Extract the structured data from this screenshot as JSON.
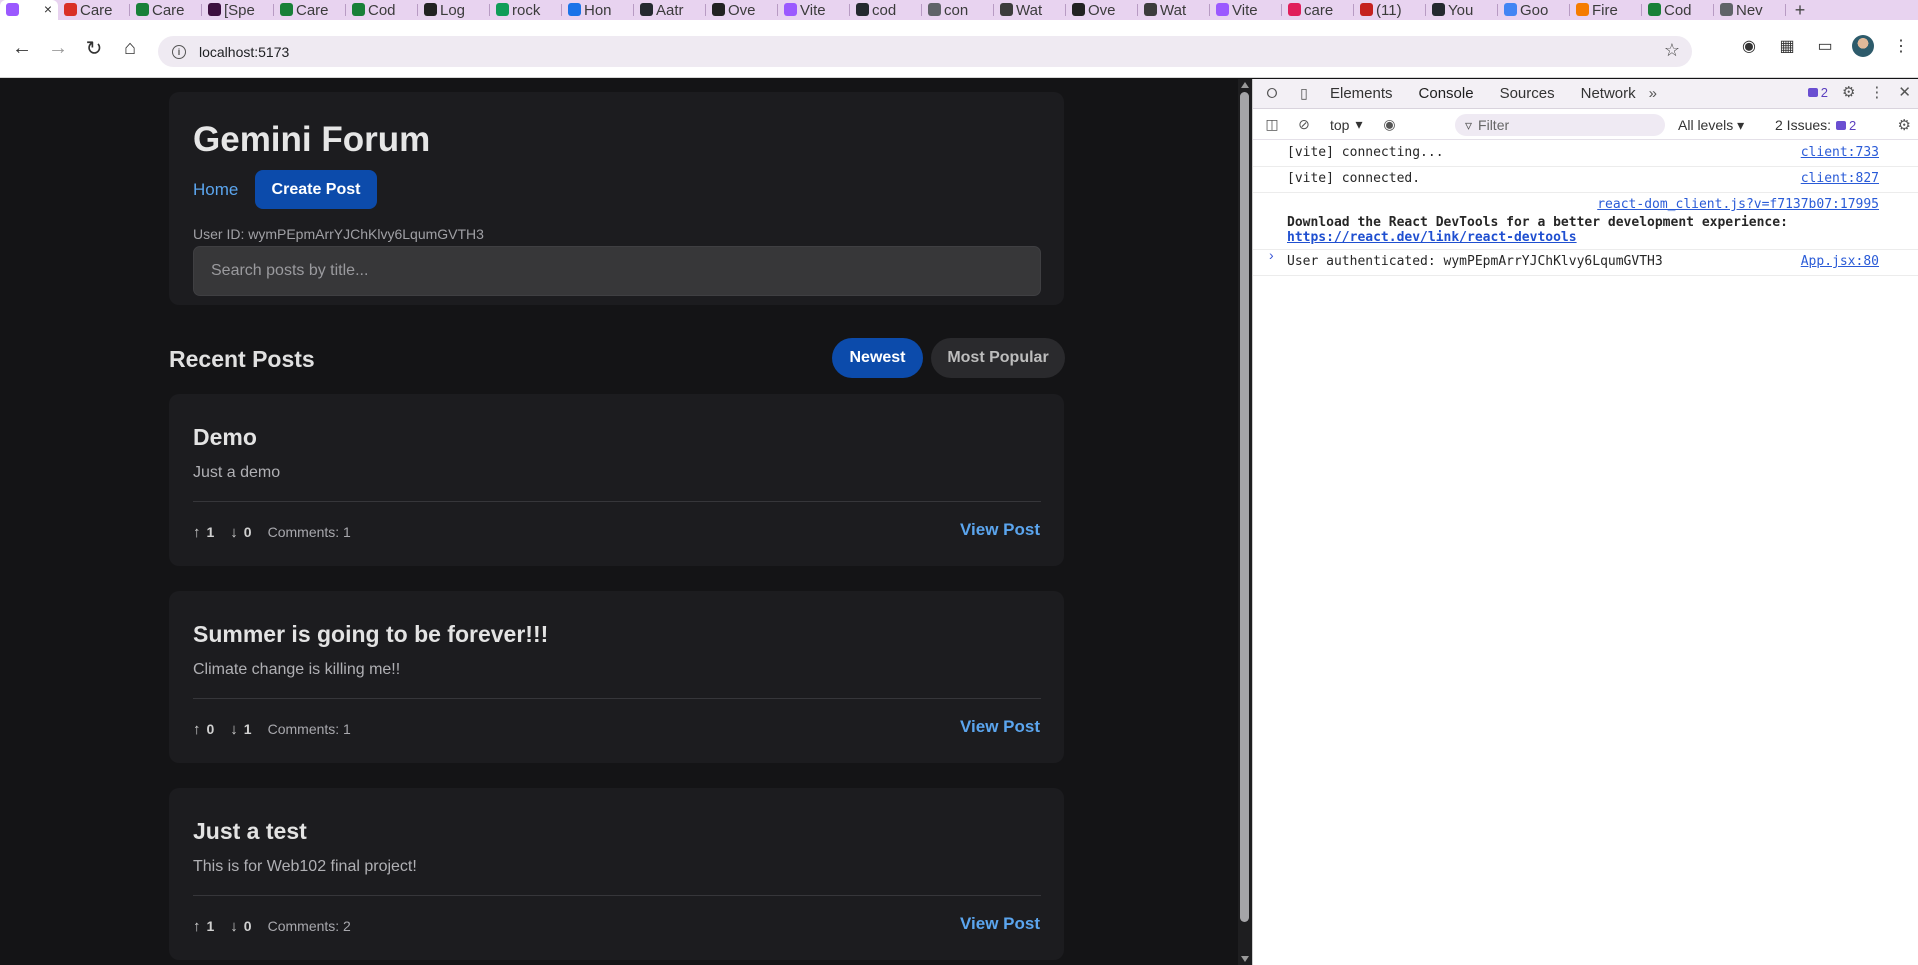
{
  "browser": {
    "tabs": [
      {
        "label": "",
        "icon": "vite-icon",
        "color": "#9b59ff",
        "active": true
      },
      {
        "label": "Care",
        "icon": "gmail-icon",
        "color": "#d93025"
      },
      {
        "label": "Care",
        "icon": "sheets-icon",
        "color": "#188038"
      },
      {
        "label": "[Spe",
        "icon": "slack-icon",
        "color": "#3c0f3f"
      },
      {
        "label": "Care",
        "icon": "sheets-icon",
        "color": "#188038"
      },
      {
        "label": "Cod",
        "icon": "sheets-icon",
        "color": "#188038"
      },
      {
        "label": "Log",
        "icon": "c-icon",
        "color": "#222222"
      },
      {
        "label": "rock",
        "icon": "chart-icon",
        "color": "#0f9d58"
      },
      {
        "label": "Hon",
        "icon": "drive-icon",
        "color": "#1a73e8"
      },
      {
        "label": "Aatr",
        "icon": "github-icon",
        "color": "#24292f"
      },
      {
        "label": "Ove",
        "icon": "c-icon",
        "color": "#222222"
      },
      {
        "label": "Vite",
        "icon": "vite-icon",
        "color": "#9b59ff"
      },
      {
        "label": "cod",
        "icon": "github-icon",
        "color": "#24292f"
      },
      {
        "label": "con",
        "icon": "globe-icon",
        "color": "#5f6368"
      },
      {
        "label": "Wat",
        "icon": "shield-icon",
        "color": "#3c3c3c"
      },
      {
        "label": "Ove",
        "icon": "c-icon",
        "color": "#222222"
      },
      {
        "label": "Wat",
        "icon": "shield-icon",
        "color": "#3c3c3c"
      },
      {
        "label": "Vite",
        "icon": "vite-icon",
        "color": "#9b59ff"
      },
      {
        "label": "care",
        "icon": "slack-icon",
        "color": "#e01e5a"
      },
      {
        "label": "(11)",
        "icon": "notion-icon",
        "color": "#c5221f"
      },
      {
        "label": "You",
        "icon": "github-icon",
        "color": "#24292f"
      },
      {
        "label": "Goo",
        "icon": "gemini-icon",
        "color": "#4285f4"
      },
      {
        "label": "Fire",
        "icon": "firebase-icon",
        "color": "#f57c00"
      },
      {
        "label": "Cod",
        "icon": "sheets-icon",
        "color": "#188038"
      },
      {
        "label": "Nev",
        "icon": "chrome-icon",
        "color": "#5f6368"
      }
    ],
    "url": "localhost:5173"
  },
  "app": {
    "title": "Gemini Forum",
    "nav_home": "Home",
    "create_post": "Create Post",
    "user_id": "User ID: wymPEpmArrYJChKlvy6LqumGVTH3",
    "search_placeholder": "Search posts by title...",
    "section_title": "Recent Posts",
    "sort_newest": "Newest",
    "sort_popular": "Most Popular",
    "posts": [
      {
        "title": "Demo",
        "body": "Just a demo",
        "up": "1",
        "down": "0",
        "comments": "Comments: 1",
        "view": "View Post"
      },
      {
        "title": "Summer is going to be forever!!!",
        "body": "Climate change is killing me!!",
        "up": "0",
        "down": "1",
        "comments": "Comments: 1",
        "view": "View Post"
      },
      {
        "title": "Just a test",
        "body": "This is for Web102 final project!",
        "up": "1",
        "down": "0",
        "comments": "Comments: 2",
        "view": "View Post"
      }
    ]
  },
  "devtools": {
    "tabs": [
      "Elements",
      "Console",
      "Sources",
      "Network"
    ],
    "messages_badge": "2",
    "context": "top",
    "filter_placeholder": "Filter",
    "levels": "All levels",
    "issues_label": "2 Issues:",
    "issues_count": "2",
    "logs": [
      {
        "msg": "[vite] connecting...",
        "src": "client:733"
      },
      {
        "msg": "[vite] connected.",
        "src": "client:827"
      },
      {
        "msg": "Download the React DevTools for a better development experience:",
        "link": "https://react.dev/link/react-devtools",
        "src": "react-dom_client.js?v=f7137b07:17995"
      },
      {
        "msg": "User authenticated: wymPEpmArrYJChKlvy6LqumGVTH3",
        "src": "App.jsx:80"
      }
    ]
  }
}
